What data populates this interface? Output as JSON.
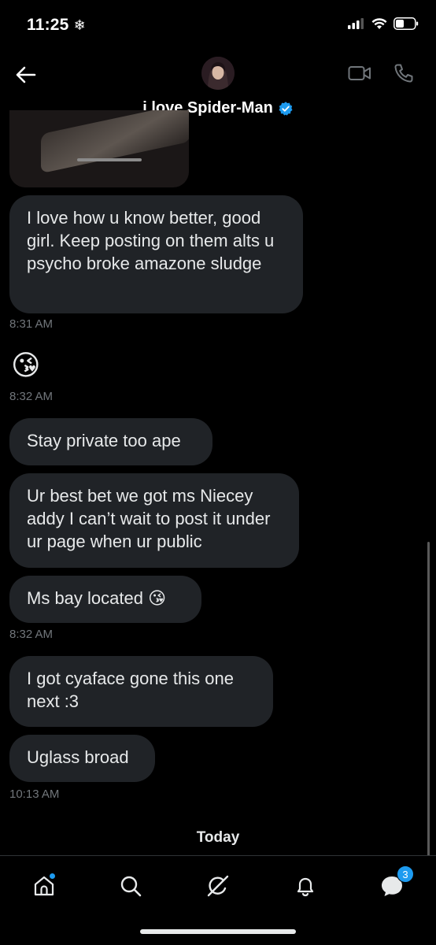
{
  "status_bar": {
    "time": "11:25",
    "snow_glyph": "❄"
  },
  "header": {
    "contact_name": "i love Spider-Man"
  },
  "messages": [
    {
      "id": "m1",
      "text": "I love how u know better, good girl. Keep posting on them alts u psycho broke amazone sludge",
      "time": "8:31 AM"
    },
    {
      "id": "m2",
      "emoji": "😘",
      "time": "8:32 AM"
    },
    {
      "id": "m3",
      "text": "Stay private too ape"
    },
    {
      "id": "m4",
      "text": "Ur best bet we got ms Niecey addy I can’t wait to post it under ur page when ur public"
    },
    {
      "id": "m5",
      "text": "Ms bay located 😘",
      "time": "8:32 AM"
    },
    {
      "id": "m6",
      "text": "I got cyaface gone this one next :3"
    },
    {
      "id": "m7",
      "text": "Uglass broad",
      "time": "10:13 AM"
    }
  ],
  "divider": {
    "today": "Today"
  },
  "nav": {
    "messages_badge": "3"
  },
  "colors": {
    "background": "#000000",
    "bubble": "#202327",
    "accent": "#1d9bf0",
    "muted_text": "#71767b"
  },
  "icons": [
    "back-arrow-icon",
    "video-call-icon",
    "phone-icon",
    "verified-badge-icon",
    "home-icon",
    "search-icon",
    "grok-icon",
    "notifications-bell-icon",
    "messages-icon"
  ]
}
